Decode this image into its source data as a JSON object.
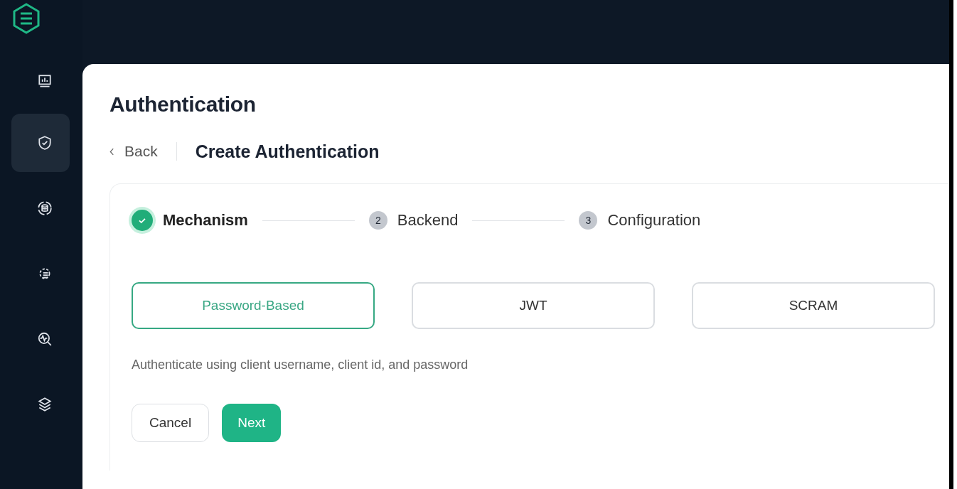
{
  "sidebar": {
    "items": [
      {
        "selected": false
      },
      {
        "selected": true
      },
      {
        "selected": false
      },
      {
        "selected": false
      },
      {
        "selected": false
      },
      {
        "selected": false
      }
    ]
  },
  "page": {
    "title": "Authentication",
    "back": "Back",
    "subtitle": "Create Authentication"
  },
  "steps": [
    {
      "label": "Mechanism",
      "done": true
    },
    {
      "number": "2",
      "label": "Backend",
      "done": false
    },
    {
      "number": "3",
      "label": "Configuration",
      "done": false
    }
  ],
  "mechanisms": [
    {
      "label": "Password-Based",
      "selected": true
    },
    {
      "label": "JWT",
      "selected": false
    },
    {
      "label": "SCRAM",
      "selected": false
    }
  ],
  "description": "Authenticate using client username, client id, and password",
  "buttons": [
    {
      "label": "Cancel",
      "kind": "secondary"
    },
    {
      "label": "Next",
      "kind": "primary"
    }
  ]
}
